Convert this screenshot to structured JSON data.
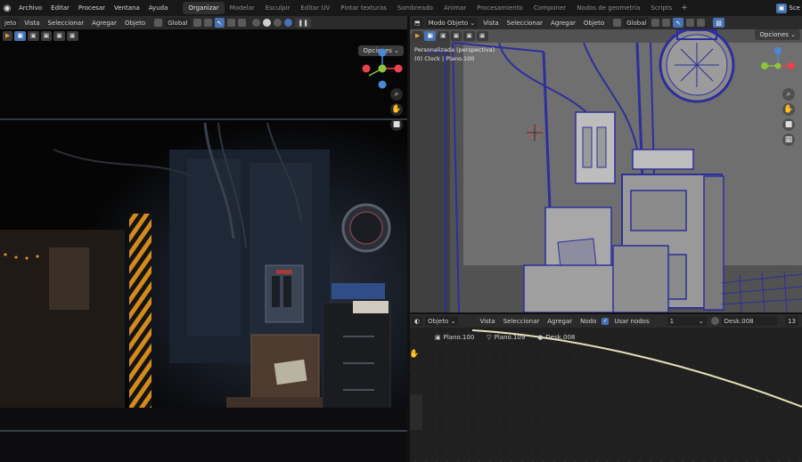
{
  "topbar": {
    "menus": [
      "Archivo",
      "Editar",
      "Procesar",
      "Ventana",
      "Ayuda"
    ],
    "workspaces": [
      "Organizar",
      "Modelar",
      "Esculpir",
      "Editar UV",
      "Pintar texturas",
      "Sombreado",
      "Animar",
      "Procesamiento",
      "Componer",
      "Nodos de geometría",
      "Scripts"
    ],
    "active_workspace": "Organizar",
    "add_tab": "+",
    "scene_label": "Sce"
  },
  "left_viewport": {
    "mode_label": "jeto",
    "menus": [
      "Vista",
      "Seleccionar",
      "Agregar",
      "Objeto"
    ],
    "orientation": "Global",
    "options_label": "Opciones"
  },
  "right_viewport": {
    "mode_label": "Modo Objeto",
    "menus": [
      "Vista",
      "Seleccionar",
      "Agregar",
      "Objeto"
    ],
    "orientation": "Global",
    "options_label": "Opciones",
    "view_name": "Personalizada (perspectiva)",
    "object_info": "(0) Clock | Plano.100"
  },
  "node_editor": {
    "object_selector": "Objeto",
    "menus": [
      "Vista",
      "Seleccionar",
      "Agregar",
      "Nodo"
    ],
    "use_nodes_label": "Usar nodos",
    "use_nodes_checked": true,
    "slot_value": "1",
    "material_name": "Desk.008",
    "user_count": "13",
    "breadcrumb": [
      "Plano.100",
      "Plano.109",
      "Desk.008"
    ]
  },
  "colors": {
    "accent": "#4772b3",
    "axis_x": "#e8434f",
    "axis_y": "#8cc43c",
    "axis_z": "#4a89d9",
    "wire": "#2e2e9c"
  }
}
